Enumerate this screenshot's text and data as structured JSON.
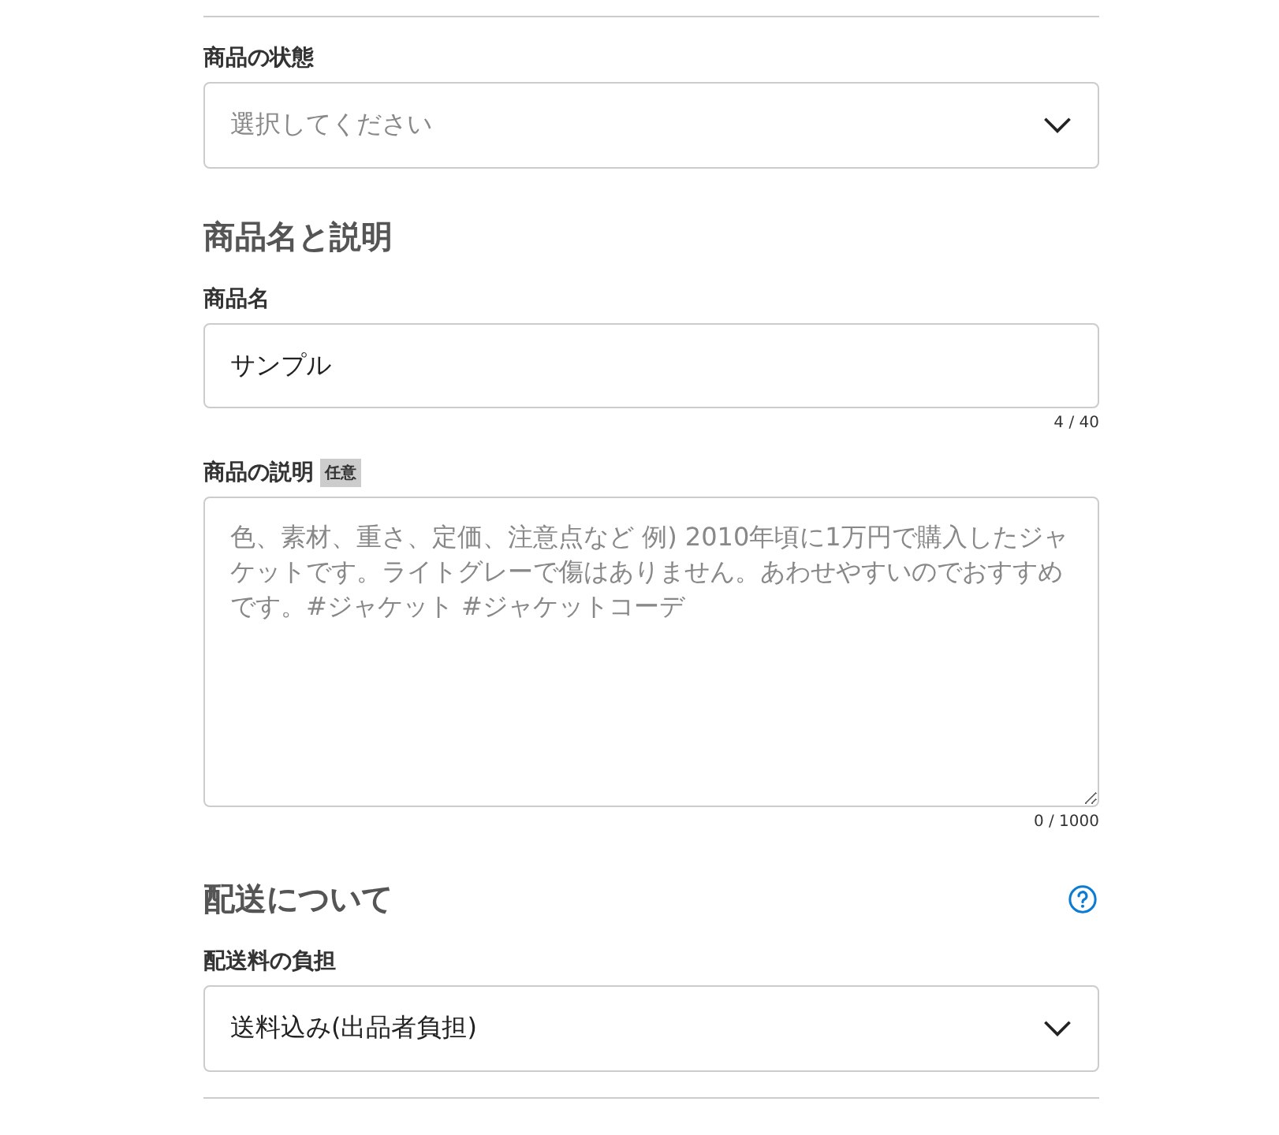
{
  "blocks": [
    {
      "kind": "select",
      "label": "商品の状態",
      "placeholder": "選択してください"
    },
    {
      "kind": "heading",
      "title": "商品名と説明",
      "help": false
    },
    {
      "kind": "text",
      "label": "商品名",
      "value": "サンプル",
      "counter": "4 / 40"
    },
    {
      "kind": "textarea",
      "label": "商品の説明",
      "badge": "任意",
      "placeholder": "色、素材、重さ、定価、注意点など 例) 2010年頃に1万円で購入したジャケットです。ライトグレーで傷はありません。あわせやすいのでおすすめです。#ジャケット #ジャケットコーデ",
      "counter": "0 / 1000"
    },
    {
      "kind": "heading",
      "title": "配送について",
      "help": true
    },
    {
      "kind": "select",
      "label": "配送料の負担",
      "value": "送料込み(出品者負担)"
    }
  ]
}
